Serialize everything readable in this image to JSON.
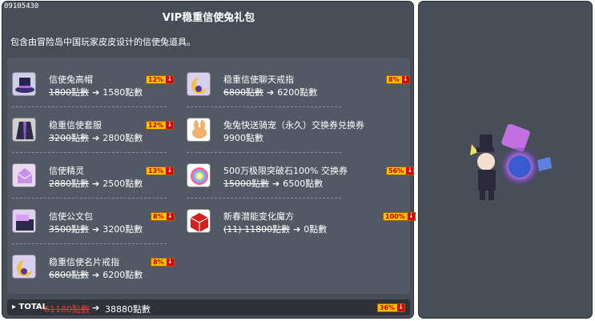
{
  "item_id": "09105430",
  "title": "VIP稳重信使兔礼包",
  "description": "包含由冒险岛中国玩家皮皮设计的信使兔道具。",
  "items": [
    {
      "name": "信使兔高帽",
      "old_price": "1800點數",
      "new_price": "1580點數",
      "discount": "12%",
      "icon": "top-hat-icon"
    },
    {
      "name": "稳重信使聊天戒指",
      "old_price": "6800點數",
      "new_price": "6200點數",
      "discount": "8%",
      "icon": "moon-ring-icon"
    },
    {
      "name": "稳重信使套服",
      "old_price": "3200點數",
      "new_price": "2800點數",
      "discount": "12%",
      "icon": "coat-icon"
    },
    {
      "name": "兔兔快送骑宠（永久）交换券兑换券",
      "old_price": "",
      "new_price": "9900點數",
      "discount": "",
      "icon": "rabbit-coupon-icon"
    },
    {
      "name": "信使精灵",
      "old_price": "2880點數",
      "new_price": "2500點數",
      "discount": "13%",
      "icon": "envelope-spirit-icon"
    },
    {
      "name": "500万极限突破石100% 交换券",
      "old_price": "15000點數",
      "new_price": "6500點數",
      "discount": "56%",
      "icon": "rainbow-burst-icon"
    },
    {
      "name": "信使公文包",
      "old_price": "3500點數",
      "new_price": "3200點數",
      "discount": "8%",
      "icon": "briefcase-icon"
    },
    {
      "name": "新春潜能变化魔方",
      "old_price": "(11) 11800點數",
      "new_price": "0點數",
      "discount": "100%",
      "icon": "cube-icon"
    },
    {
      "name": "稳重信使名片戒指",
      "old_price": "6800點數",
      "new_price": "6200點數",
      "discount": "8%",
      "icon": "moon-ring-icon"
    }
  ],
  "total": {
    "label": "TOTAL",
    "old_price": "61180點數",
    "new_price": "38880點數",
    "discount": "36%"
  },
  "colors": {
    "panel": "#484e58",
    "inner": "#525965",
    "discount_bg": "#f6c300",
    "discount_text": "#cc0000",
    "total_old": "#e23b3b"
  }
}
